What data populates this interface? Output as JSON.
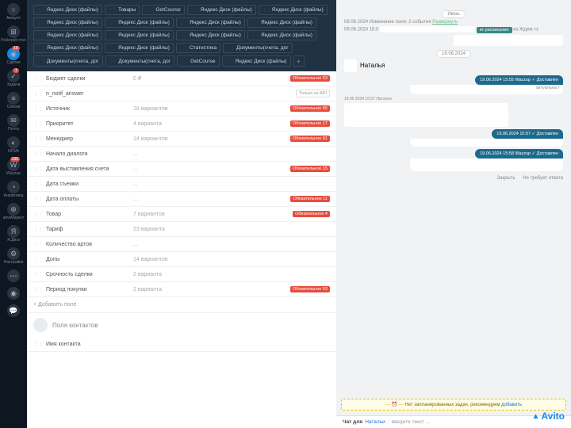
{
  "sidebar": [
    {
      "label": "Аккаунт",
      "icon": "○",
      "badge": null
    },
    {
      "label": "Рабочий стол",
      "icon": "⊞",
      "badge": null
    },
    {
      "label": "Сделки",
      "icon": "◉",
      "badge": "10",
      "active": true
    },
    {
      "label": "Задачи",
      "icon": "✓",
      "badge": "1"
    },
    {
      "label": "Списки",
      "icon": "≡",
      "badge": null
    },
    {
      "label": "Почта",
      "icon": "✉",
      "badge": null
    },
    {
      "label": "NOVA",
      "icon": "◐",
      "badge": null
    },
    {
      "label": "Wazzup",
      "icon": "W",
      "badge": "139"
    },
    {
      "label": "Аналитика",
      "icon": "◔",
      "badge": null
    },
    {
      "label": "amoМаркет",
      "icon": "⊕",
      "badge": null
    },
    {
      "label": "Я.Диск",
      "icon": "Я",
      "badge": null
    },
    {
      "label": "Настройки",
      "icon": "⚙",
      "badge": null
    }
  ],
  "tags": [
    [
      "Яндекс Диск (файлы)",
      "Товары",
      "GetCourse",
      "Яндекс Диск (файлы)"
    ],
    [
      "Яндекс Диск (файлы)",
      "Яндекс Диск (файлы)",
      "Яндекс Диск (файлы)"
    ],
    [
      "Яндекс Диск (файлы)",
      "Яндекс Диск (файлы)",
      "Яндекс Диск (файлы)"
    ],
    [
      "Яндекс Диск (файлы)",
      "Яндекс Диск (файлы)",
      "Яндекс Диск (файлы)"
    ],
    [
      "Яндекс Диск (файлы)",
      "Яндекс Диск (файлы)",
      "Статистика",
      "Документы(счета, дог"
    ],
    [
      "Документы(счета, дог",
      "Документы(счета, дог",
      "GetCourse",
      "Яндекс Диск (файлы)"
    ]
  ],
  "add_tag": "+",
  "fields": [
    {
      "name": "Бюджет сделки",
      "val": "0 ₽",
      "req": "Обязательное 53"
    },
    {
      "name": "n_notif_answer",
      "val": "",
      "api": "Только из API"
    },
    {
      "name": "Источник",
      "val": "18 вариантов",
      "req": "Обязательное 65"
    },
    {
      "name": "Приоритет",
      "val": "4 варианта",
      "req": "Обязательное 17"
    },
    {
      "name": "Менеджер",
      "val": "14 вариантов",
      "req": "Обязательное 61"
    },
    {
      "name": "Начало диалога",
      "val": "..."
    },
    {
      "name": "Дата выставления счета",
      "val": "...",
      "req": "Обязательное 15"
    },
    {
      "name": "Дата съемки",
      "val": "..."
    },
    {
      "name": "Дата оплаты",
      "val": "...",
      "req": "Обязательное 11"
    },
    {
      "name": "Товар",
      "val": "7 вариантов",
      "req": "Обязательное 4"
    },
    {
      "name": "Тариф",
      "val": "23 варианта"
    },
    {
      "name": "Количество артов",
      "val": "..."
    },
    {
      "name": "Допы",
      "val": "14 вариантов"
    },
    {
      "name": "Срочность сделки",
      "val": "2 варианта"
    },
    {
      "name": "Период покупки",
      "val": "2 варианта",
      "req": "Обязательное 53"
    }
  ],
  "add_field": "+ Добавить поле",
  "contacts_section": "Поля контактов",
  "contact_name_label": "Имя контакта",
  "feed": {
    "month": "Июнь",
    "ev1": "09.06.2024 Изменение поля: 2 события ",
    "ev1_link": "Развернуть",
    "ev2_pre": "09.06.2024 16:0",
    "ev2_chip": "ет расписание",
    "ev2_post": " из Ждем тз",
    "date_sep": "19.06.2024",
    "contact_name": "Наталья",
    "out1_meta": "19.06.2024 15:55 Wazzup ✓ Доставлен",
    "out1_tail": "актуальна т",
    "in_meta": "19.06 2024 15:57 Наталья",
    "out2_meta": "19.06.2024 15:57                ✓ Доставлен",
    "out3_meta": "19.06.2024 15:58 Wazzup ✓ Доставлен",
    "action_close": "Закрыть",
    "action_noreply": "Не требует ответа"
  },
  "notask": {
    "text": "Нет запланированных задач, рекомендуем ",
    "link": "добавить"
  },
  "chat": {
    "pre": "Чат для ",
    "name": "Натальи",
    "sep": ":",
    "ph": "введите текст ..."
  },
  "watermark": "Avito"
}
